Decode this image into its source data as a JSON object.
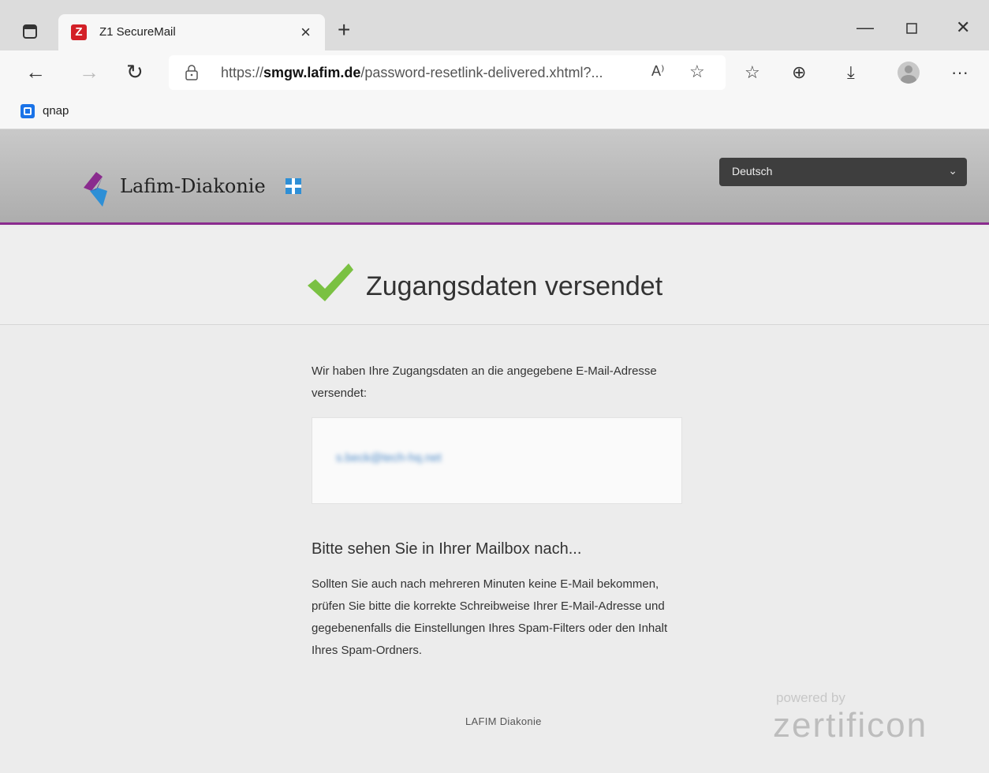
{
  "browser": {
    "tab_title": "Z1 SecureMail",
    "tab_favicon_letter": "Z",
    "url_prefix": "https://",
    "url_domain": "smgw.lafim.de",
    "url_path": "/password-resetlink-delivered.xhtml?...",
    "read_aloud_label": "A⁾",
    "bookmark_label": "qnap",
    "icons": [
      "tab-actions-icon",
      "close-icon",
      "new-tab-icon",
      "minimize-icon",
      "maximize-icon",
      "window-close-icon",
      "back-icon",
      "forward-icon",
      "refresh-icon",
      "lock-icon",
      "read-aloud-icon",
      "add-favorite-icon",
      "favorites-icon",
      "collections-icon",
      "download-icon",
      "profile-icon",
      "more-icon"
    ]
  },
  "header": {
    "brand": "Lafim-Diakonie",
    "language": "Deutsch"
  },
  "main": {
    "heading": "Zugangsdaten versendet",
    "intro": "Wir haben Ihre Zugangsdaten an die angegebene E-Mail-Adresse versendet:",
    "email": "s.beck@tech-hq.net",
    "subheading": "Bitte sehen Sie in Ihrer Mailbox nach...",
    "body": "Sollten Sie auch nach mehreren Minuten keine E-Mail bekommen, prüfen Sie bitte die korrekte Schreibweise Ihrer E-Mail-Adresse und gegebenenfalls die Einstellungen Ihres Spam-Filters oder den Inhalt Ihres Spam-Ordners."
  },
  "footer": {
    "org": "LAFIM Diakonie",
    "powered_by": "powered by",
    "vendor": "zertificon"
  },
  "colors": {
    "accent_purple": "#8a2b8e",
    "check_green": "#7ac142",
    "logo_blue": "#2e8fd6"
  }
}
